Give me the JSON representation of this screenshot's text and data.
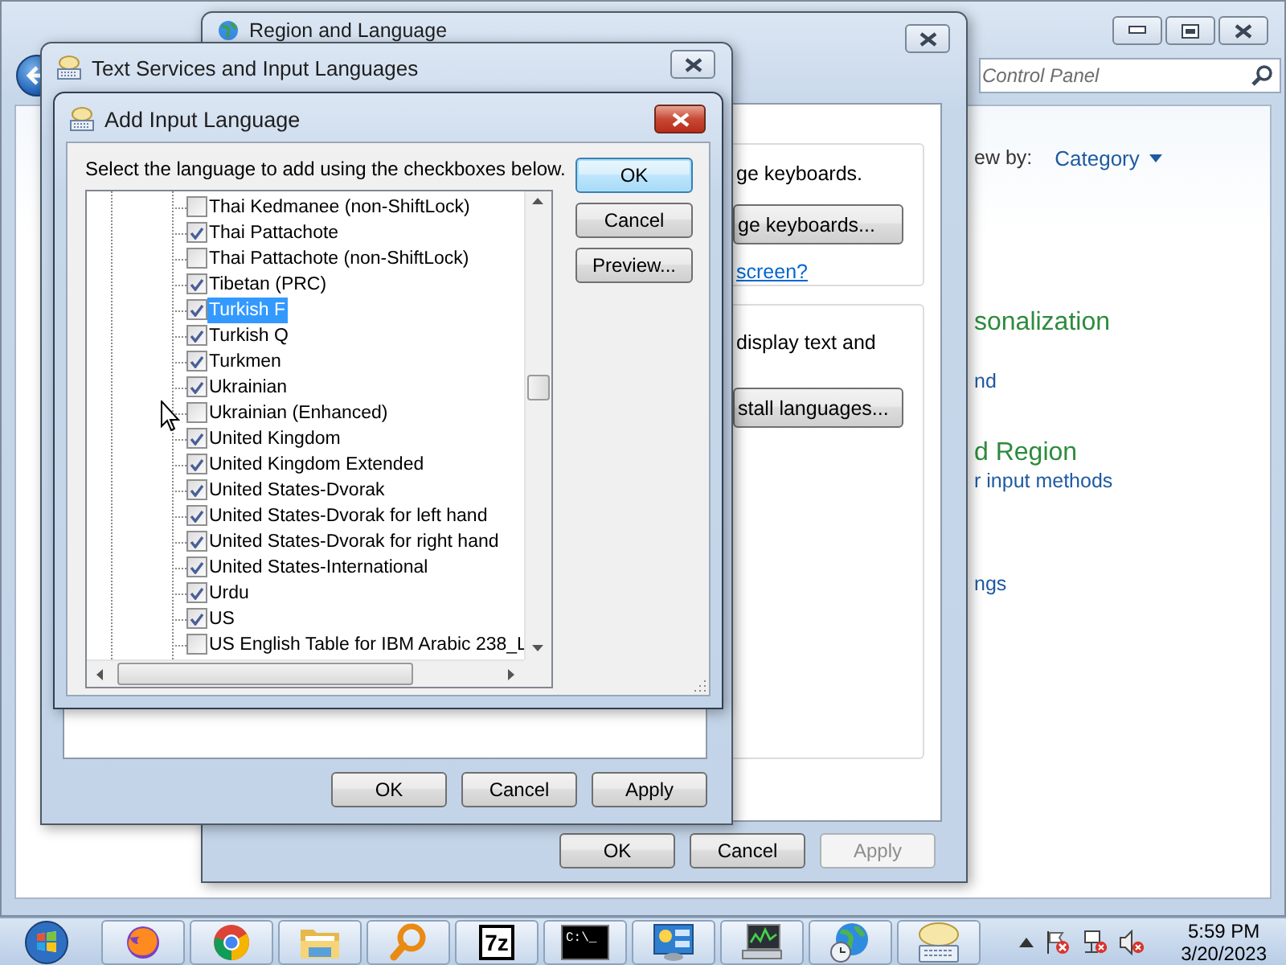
{
  "control_panel": {
    "search": {
      "placeholder": "Control Panel"
    },
    "view_by_label": "ew by:",
    "view_by_value": "Category",
    "items": [
      {
        "kind": "heading",
        "text": "sonalization"
      },
      {
        "kind": "link",
        "text": "nd"
      },
      {
        "kind": "heading",
        "text": "d Region"
      },
      {
        "kind": "link",
        "text": "r input methods"
      },
      {
        "kind": "link",
        "text": "ngs"
      }
    ]
  },
  "region_window": {
    "title": "Region and Language",
    "keyboards_text": "ge keyboards.",
    "keyboards_button": "ge keyboards...",
    "screen_link": "screen?",
    "display_text": "display text and",
    "install_button": "stall languages...",
    "buttons": [
      {
        "label": "OK",
        "disabled": false
      },
      {
        "label": "Cancel",
        "disabled": false
      },
      {
        "label": "Apply",
        "disabled": true
      }
    ]
  },
  "text_services_window": {
    "title": "Text Services and Input Languages",
    "buttons": [
      {
        "label": "OK",
        "disabled": false
      },
      {
        "label": "Cancel",
        "disabled": false
      },
      {
        "label": "Apply",
        "disabled": false
      }
    ]
  },
  "add_language_dialog": {
    "title": "Add Input Language",
    "instruction": "Select the language to add using the checkboxes below.",
    "buttons": [
      {
        "label": "OK",
        "default": true
      },
      {
        "label": "Cancel",
        "default": false
      },
      {
        "label": "Preview...",
        "default": false
      }
    ],
    "items": [
      {
        "label": "Thai Kedmanee (non-ShiftLock)",
        "checked": false,
        "selected": false
      },
      {
        "label": "Thai Pattachote",
        "checked": true,
        "selected": false
      },
      {
        "label": "Thai Pattachote (non-ShiftLock)",
        "checked": false,
        "selected": false
      },
      {
        "label": "Tibetan (PRC)",
        "checked": true,
        "selected": false
      },
      {
        "label": "Turkish F",
        "checked": true,
        "selected": true
      },
      {
        "label": "Turkish Q",
        "checked": true,
        "selected": false
      },
      {
        "label": "Turkmen",
        "checked": true,
        "selected": false
      },
      {
        "label": "Ukrainian",
        "checked": true,
        "selected": false
      },
      {
        "label": "Ukrainian (Enhanced)",
        "checked": false,
        "selected": false
      },
      {
        "label": "United Kingdom",
        "checked": true,
        "selected": false
      },
      {
        "label": "United Kingdom Extended",
        "checked": true,
        "selected": false
      },
      {
        "label": "United States-Dvorak",
        "checked": true,
        "selected": false
      },
      {
        "label": "United States-Dvorak for left hand",
        "checked": true,
        "selected": false
      },
      {
        "label": "United States-Dvorak for right hand",
        "checked": true,
        "selected": false
      },
      {
        "label": "United States-International",
        "checked": true,
        "selected": false
      },
      {
        "label": "Urdu",
        "checked": true,
        "selected": false
      },
      {
        "label": "US",
        "checked": true,
        "selected": false
      },
      {
        "label": "US English Table for IBM Arabic 238_L",
        "checked": false,
        "selected": false
      }
    ]
  },
  "taskbar": {
    "buttons": [
      {
        "kind": "firefox"
      },
      {
        "kind": "chrome"
      },
      {
        "kind": "folder"
      },
      {
        "kind": "search"
      },
      {
        "kind": "archive",
        "text": "7z"
      },
      {
        "kind": "terminal",
        "text": "C:\\_"
      },
      {
        "kind": "control"
      },
      {
        "kind": "monitor"
      },
      {
        "kind": "globe"
      },
      {
        "kind": "keyboard"
      }
    ],
    "time": "5:59 PM",
    "date": "3/20/2023"
  }
}
